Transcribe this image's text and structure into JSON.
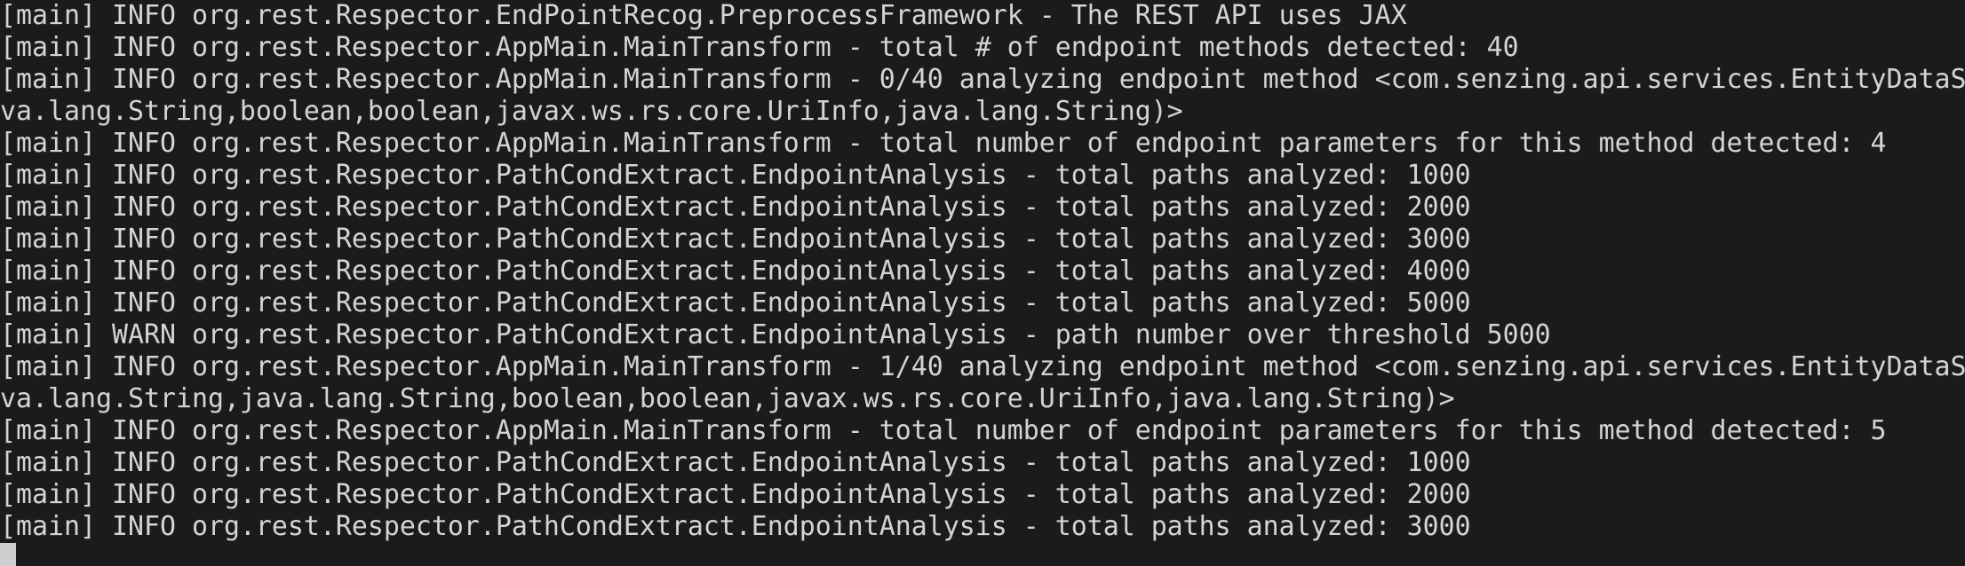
{
  "terminal": {
    "lines": [
      "[main] INFO org.rest.Respector.EndPointRecog.PreprocessFramework - The REST API uses JAX",
      "[main] INFO org.rest.Respector.AppMain.MainTransform - total # of endpoint methods detected: 40",
      "[main] INFO org.rest.Respector.AppMain.MainTransform - 0/40 analyzing endpoint method <com.senzing.api.services.EntityDataS",
      "va.lang.String,boolean,boolean,javax.ws.rs.core.UriInfo,java.lang.String)>",
      "[main] INFO org.rest.Respector.AppMain.MainTransform - total number of endpoint parameters for this method detected: 4",
      "[main] INFO org.rest.Respector.PathCondExtract.EndpointAnalysis - total paths analyzed: 1000",
      "[main] INFO org.rest.Respector.PathCondExtract.EndpointAnalysis - total paths analyzed: 2000",
      "[main] INFO org.rest.Respector.PathCondExtract.EndpointAnalysis - total paths analyzed: 3000",
      "[main] INFO org.rest.Respector.PathCondExtract.EndpointAnalysis - total paths analyzed: 4000",
      "[main] INFO org.rest.Respector.PathCondExtract.EndpointAnalysis - total paths analyzed: 5000",
      "[main] WARN org.rest.Respector.PathCondExtract.EndpointAnalysis - path number over threshold 5000",
      "[main] INFO org.rest.Respector.AppMain.MainTransform - 1/40 analyzing endpoint method <com.senzing.api.services.EntityDataS",
      "va.lang.String,java.lang.String,boolean,boolean,javax.ws.rs.core.UriInfo,java.lang.String)>",
      "[main] INFO org.rest.Respector.AppMain.MainTransform - total number of endpoint parameters for this method detected: 5",
      "[main] INFO org.rest.Respector.PathCondExtract.EndpointAnalysis - total paths analyzed: 1000",
      "[main] INFO org.rest.Respector.PathCondExtract.EndpointAnalysis - total paths analyzed: 2000",
      "[main] INFO org.rest.Respector.PathCondExtract.EndpointAnalysis - total paths analyzed: 3000"
    ]
  }
}
